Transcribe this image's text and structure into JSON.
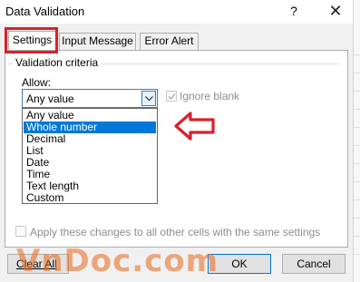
{
  "window": {
    "title": "Data Validation",
    "help_label": "?",
    "close_label": "✕"
  },
  "tabs": [
    {
      "label": "Settings",
      "active": true
    },
    {
      "label": "Input Message",
      "active": false
    },
    {
      "label": "Error Alert",
      "active": false
    }
  ],
  "validation": {
    "group_title": "Validation criteria",
    "allow_label": "Allow:",
    "allow_value": "Any value",
    "ignore_blank_label": "Ignore blank",
    "ignore_blank_checked": true,
    "options": [
      {
        "label": "Any value",
        "selected": false
      },
      {
        "label": "Whole number",
        "selected": true
      },
      {
        "label": "Decimal",
        "selected": false
      },
      {
        "label": "List",
        "selected": false
      },
      {
        "label": "Date",
        "selected": false
      },
      {
        "label": "Time",
        "selected": false
      },
      {
        "label": "Text length",
        "selected": false
      },
      {
        "label": "Custom",
        "selected": false
      }
    ]
  },
  "apply_all": {
    "label": "Apply these changes to all other cells with the same settings",
    "checked": false
  },
  "buttons": {
    "clear_all": "Clear All",
    "ok": "OK",
    "cancel": "Cancel"
  },
  "watermark": "VnDoc.com",
  "colors": {
    "highlight": "#d9202b",
    "selection": "#0078d7",
    "watermark": "#e86818"
  }
}
